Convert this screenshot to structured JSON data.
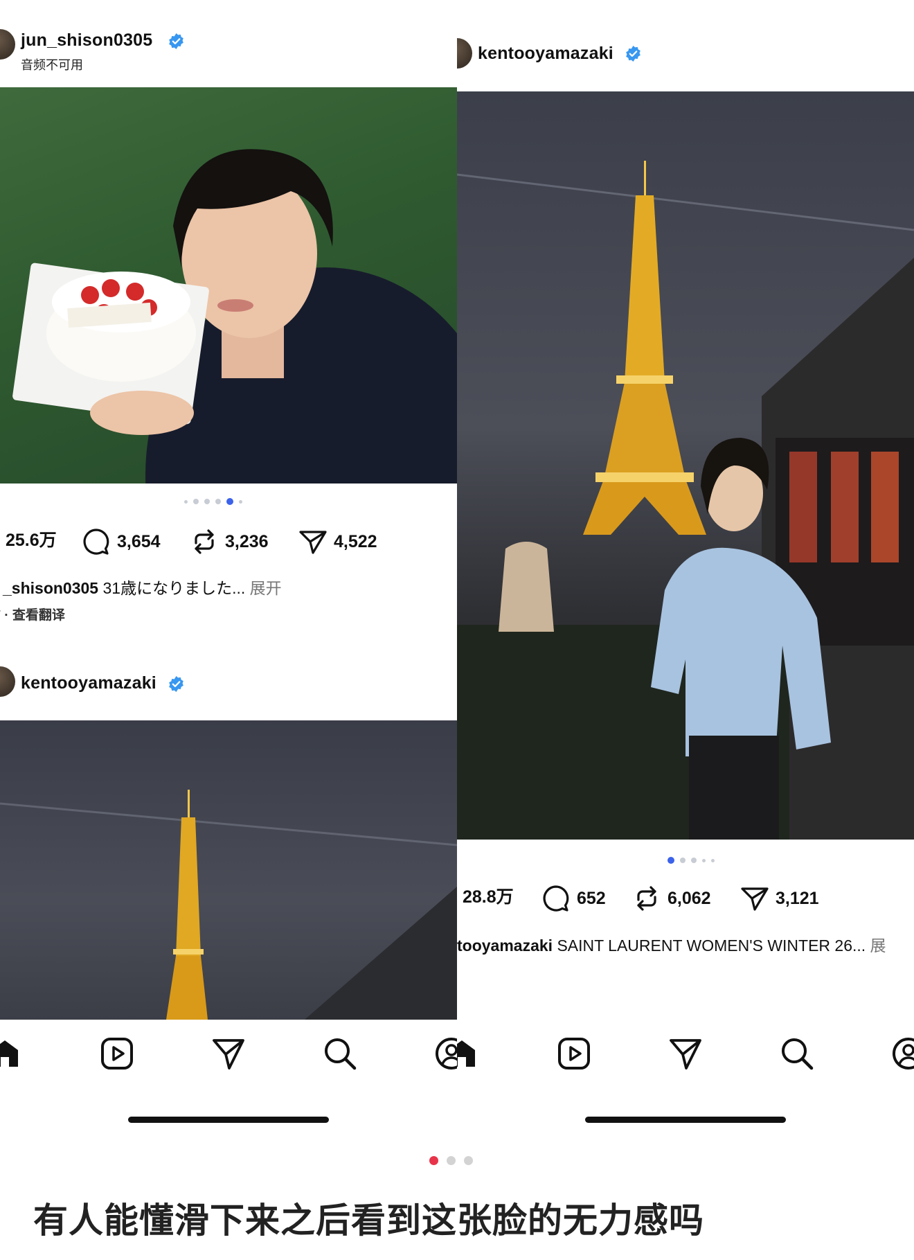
{
  "left": {
    "username": "jun_shison0305",
    "subline": "音频不可用",
    "stats": {
      "likes": "25.6万",
      "comments": "3,654",
      "reposts": "3,236",
      "shares": "4,522"
    },
    "caption_user": "_shison0305",
    "caption_text": " 31歳になりました...",
    "caption_more": " 展开",
    "caption_sub": "前 · 查看翻译",
    "next_post_username": "kentooyamazaki"
  },
  "right": {
    "username": "kentooyamazaki",
    "stats": {
      "likes": "28.8万",
      "comments": "652",
      "reposts": "6,062",
      "shares": "3,121"
    },
    "caption_user": "tooyamazaki",
    "caption_text": " SAINT LAURENT WOMEN'S WINTER 26...",
    "caption_more": " 展"
  },
  "bottom_caption": "有人能懂滑下来之后看到这张脸的无力感吗",
  "colors": {
    "verified": "#3897f0",
    "carousel_active": "#3b62ea",
    "page_active": "#e8344a"
  },
  "icons": [
    "verified-badge-icon",
    "heart-icon",
    "comment-icon",
    "repost-icon",
    "share-icon",
    "home-icon",
    "reels-icon",
    "send-icon",
    "search-icon",
    "profile-icon"
  ]
}
